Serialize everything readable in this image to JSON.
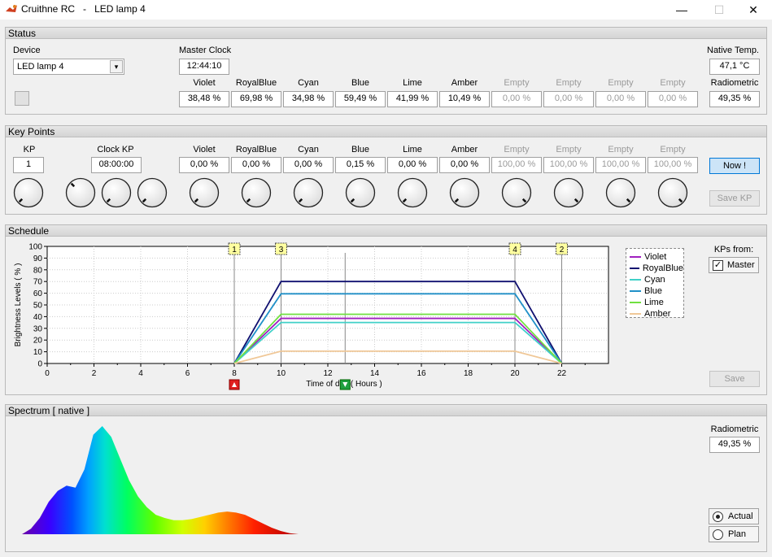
{
  "window": {
    "app": "Cruithne RC",
    "separator": "-",
    "device": "LED lamp 4",
    "min": "—",
    "max": "☐",
    "close": "✕"
  },
  "status": {
    "title": "Status",
    "device_label": "Device",
    "device_value": "LED lamp 4",
    "master_clock_label": "Master Clock",
    "master_clock_value": "12:44:10",
    "native_temp_label": "Native  Temp.",
    "native_temp_value": "47,1 °C",
    "radiometric_label": "Radiometric",
    "radiometric_value": "49,35 %",
    "channels": [
      {
        "name": "Violet",
        "value": "38,48 %",
        "dim": false
      },
      {
        "name": "RoyalBlue",
        "value": "69,98 %",
        "dim": false
      },
      {
        "name": "Cyan",
        "value": "34,98 %",
        "dim": false
      },
      {
        "name": "Blue",
        "value": "59,49 %",
        "dim": false
      },
      {
        "name": "Lime",
        "value": "41,99 %",
        "dim": false
      },
      {
        "name": "Amber",
        "value": "10,49 %",
        "dim": false
      },
      {
        "name": "Empty",
        "value": "0,00 %",
        "dim": true
      },
      {
        "name": "Empty",
        "value": "0,00 %",
        "dim": true
      },
      {
        "name": "Empty",
        "value": "0,00 %",
        "dim": true
      },
      {
        "name": "Empty",
        "value": "0,00 %",
        "dim": true
      }
    ]
  },
  "keypoints": {
    "title": "Key Points",
    "kp_label": "KP",
    "kp_value": "1",
    "clock_label": "Clock  KP",
    "clock_value": "08:00:00",
    "now_button": "Now !",
    "save_kp_button": "Save  KP",
    "channels": [
      {
        "name": "Violet",
        "value": "0,00 %",
        "dim": false
      },
      {
        "name": "RoyalBlue",
        "value": "0,00 %",
        "dim": false
      },
      {
        "name": "Cyan",
        "value": "0,00 %",
        "dim": false
      },
      {
        "name": "Blue",
        "value": "0,15 %",
        "dim": false
      },
      {
        "name": "Lime",
        "value": "0,00 %",
        "dim": false
      },
      {
        "name": "Amber",
        "value": "0,00 %",
        "dim": false
      },
      {
        "name": "Empty",
        "value": "100,00 %",
        "dim": true
      },
      {
        "name": "Empty",
        "value": "100,00 %",
        "dim": true
      },
      {
        "name": "Empty",
        "value": "100,00 %",
        "dim": true
      },
      {
        "name": "Empty",
        "value": "100,00 %",
        "dim": true
      }
    ],
    "knob_levels": [
      0.0,
      0.0,
      0.0,
      0.0,
      0.0,
      0.0,
      0.0,
      0.0,
      0.0,
      0.0,
      1.0,
      1.0,
      1.0,
      1.0
    ]
  },
  "schedule": {
    "title": "Schedule",
    "kps_from_label": "KPs from:",
    "master_checkbox_label": "Master",
    "master_checked": true,
    "save_button": "Save",
    "current_time_hours": 12.74,
    "markers": [
      {
        "label": "1",
        "x": 8
      },
      {
        "label": "3",
        "x": 10
      },
      {
        "label": "4",
        "x": 20
      },
      {
        "label": "2",
        "x": 22
      }
    ]
  },
  "chart_data": {
    "type": "line",
    "xlabel": "Time of day  ( Hours )",
    "ylabel": "Brightness Levels  ( % )",
    "xlim": [
      0,
      24
    ],
    "ylim": [
      0,
      100
    ],
    "xticks": [
      0,
      2,
      4,
      6,
      8,
      10,
      12,
      14,
      16,
      18,
      20,
      22
    ],
    "yticks": [
      0,
      10,
      20,
      30,
      40,
      50,
      60,
      70,
      80,
      90,
      100
    ],
    "grid": true,
    "legend_position": "right",
    "x": [
      8,
      10,
      20,
      22
    ],
    "series": [
      {
        "name": "Violet",
        "color": "#a020c0",
        "values": [
          0,
          38.5,
          38.5,
          0
        ]
      },
      {
        "name": "RoyalBlue",
        "color": "#101070",
        "values": [
          0,
          70,
          70,
          0
        ]
      },
      {
        "name": "Cyan",
        "color": "#40d0c8",
        "values": [
          0,
          35,
          35,
          0
        ]
      },
      {
        "name": "Blue",
        "color": "#2090c8",
        "values": [
          0,
          59.5,
          59.5,
          0
        ]
      },
      {
        "name": "Lime",
        "color": "#70e040",
        "values": [
          0,
          42,
          42,
          0
        ]
      },
      {
        "name": "Amber",
        "color": "#f0c898",
        "values": [
          0,
          10.5,
          10.5,
          0
        ]
      }
    ]
  },
  "spectrum": {
    "title": "Spectrum  [ native ]",
    "radiometric_label": "Radiometric",
    "radiometric_value": "49,35 %",
    "actual_label": "Actual",
    "plan_label": "Plan",
    "actual_selected": true,
    "profile": [
      0,
      0.05,
      0.15,
      0.3,
      0.4,
      0.45,
      0.43,
      0.6,
      0.92,
      1.0,
      0.9,
      0.7,
      0.5,
      0.35,
      0.25,
      0.18,
      0.15,
      0.13,
      0.13,
      0.14,
      0.16,
      0.18,
      0.2,
      0.21,
      0.2,
      0.18,
      0.14,
      0.1,
      0.06,
      0.03,
      0.01,
      0
    ]
  }
}
